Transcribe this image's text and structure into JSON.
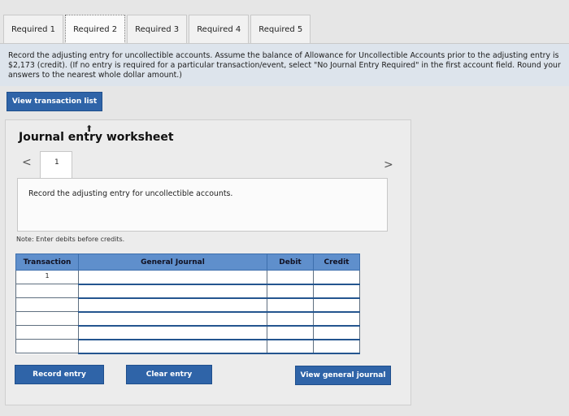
{
  "tabs": [
    {
      "label": "Required 1",
      "active": false
    },
    {
      "label": "Required 2",
      "active": true
    },
    {
      "label": "Required 3",
      "active": false
    },
    {
      "label": "Required 4",
      "active": false
    },
    {
      "label": "Required 5",
      "active": false
    }
  ],
  "instructions": "Record the adjusting entry for uncollectible accounts. Assume the balance of Allowance for Uncollectible Accounts prior to the adjusting entry is $2,173 (credit). (If no entry is required for a particular transaction/event, select \"No Journal Entry Required\" in the first account field. Round your answers to the nearest whole dollar amount.)",
  "view_transaction_list_label": "View transaction list",
  "worksheet": {
    "title": "Journal entry worksheet",
    "prev_glyph": "<",
    "next_glyph": ">",
    "page_number": "1",
    "entry_description": "Record the adjusting entry for uncollectible accounts.",
    "note": "Note: Enter debits before credits.",
    "table": {
      "headers": [
        "Transaction",
        "General Journal",
        "Debit",
        "Credit"
      ],
      "rows": [
        {
          "transaction": "1"
        },
        {
          "transaction": ""
        },
        {
          "transaction": ""
        },
        {
          "transaction": ""
        },
        {
          "transaction": ""
        },
        {
          "transaction": ""
        }
      ]
    },
    "buttons": {
      "record": "Record entry",
      "clear": "Clear entry",
      "view_general_journal": "View general journal"
    }
  },
  "colors": {
    "button": "#2f64a8",
    "table_header": "#5f8fcc",
    "instruction_bg": "#dde4ec"
  }
}
